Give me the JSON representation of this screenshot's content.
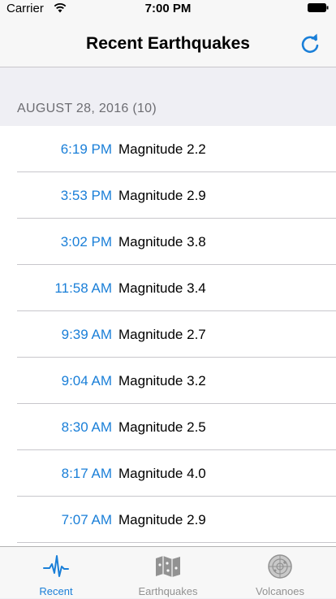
{
  "status_bar": {
    "carrier": "Carrier",
    "time": "7:00 PM"
  },
  "nav": {
    "title": "Recent Earthquakes",
    "refresh_icon": "refresh-icon"
  },
  "section": {
    "header": "AUGUST 28, 2016 (10)"
  },
  "quakes": [
    {
      "time": "6:19 PM",
      "magnitude": "Magnitude 2.2"
    },
    {
      "time": "3:53 PM",
      "magnitude": "Magnitude 2.9"
    },
    {
      "time": "3:02 PM",
      "magnitude": "Magnitude 3.8"
    },
    {
      "time": "11:58 AM",
      "magnitude": "Magnitude 3.4"
    },
    {
      "time": "9:39 AM",
      "magnitude": "Magnitude 2.7"
    },
    {
      "time": "9:04 AM",
      "magnitude": "Magnitude 3.2"
    },
    {
      "time": "8:30 AM",
      "magnitude": "Magnitude 2.5"
    },
    {
      "time": "8:17 AM",
      "magnitude": "Magnitude 4.0"
    },
    {
      "time": "7:07 AM",
      "magnitude": "Magnitude 2.9"
    }
  ],
  "tabs": [
    {
      "label": "Recent",
      "icon": "pulse-icon",
      "active": true
    },
    {
      "label": "Earthquakes",
      "icon": "map-icon",
      "active": false
    },
    {
      "label": "Volcanoes",
      "icon": "radar-icon",
      "active": false
    }
  ],
  "colors": {
    "accent": "#1a7fd8",
    "inactive": "#929292",
    "separator": "#c8c7cc"
  }
}
